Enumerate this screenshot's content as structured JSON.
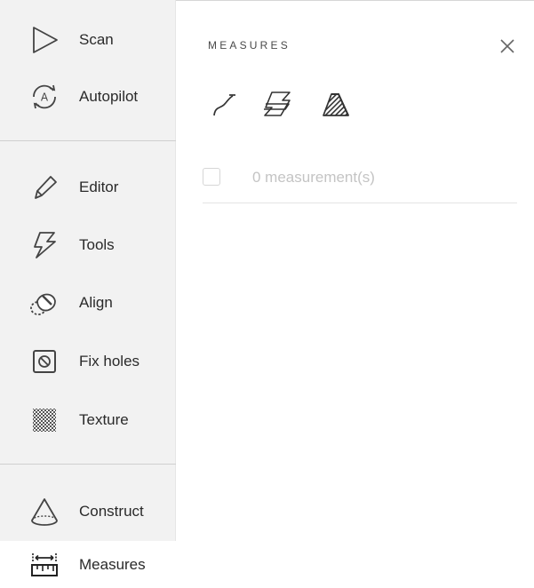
{
  "sidebar": {
    "items": [
      {
        "id": "scan",
        "label": "Scan",
        "icon": "play-triangle-icon"
      },
      {
        "id": "autopilot",
        "label": "Autopilot",
        "icon": "autopilot-icon"
      },
      {
        "id": "editor",
        "label": "Editor",
        "icon": "pencil-icon"
      },
      {
        "id": "tools",
        "label": "Tools",
        "icon": "lightning-tools-icon"
      },
      {
        "id": "align",
        "label": "Align",
        "icon": "align-icon"
      },
      {
        "id": "fixholes",
        "label": "Fix holes",
        "icon": "fix-holes-icon"
      },
      {
        "id": "texture",
        "label": "Texture",
        "icon": "checkerboard-texture-icon"
      },
      {
        "id": "construct",
        "label": "Construct",
        "icon": "cone-icon"
      },
      {
        "id": "measures",
        "label": "Measures",
        "icon": "ruler-icon",
        "active": true
      }
    ]
  },
  "panel": {
    "title": "MEASURES",
    "close_icon": "close-icon",
    "tools": [
      "curve-measure-icon",
      "section-measure-icon",
      "area-measure-icon"
    ],
    "row": {
      "label": "0 measurement(s)"
    }
  },
  "colors": {
    "sidebar_bg": "#f2f2f2",
    "active_bg": "#ffffff",
    "muted_text": "#c4c4c4"
  }
}
